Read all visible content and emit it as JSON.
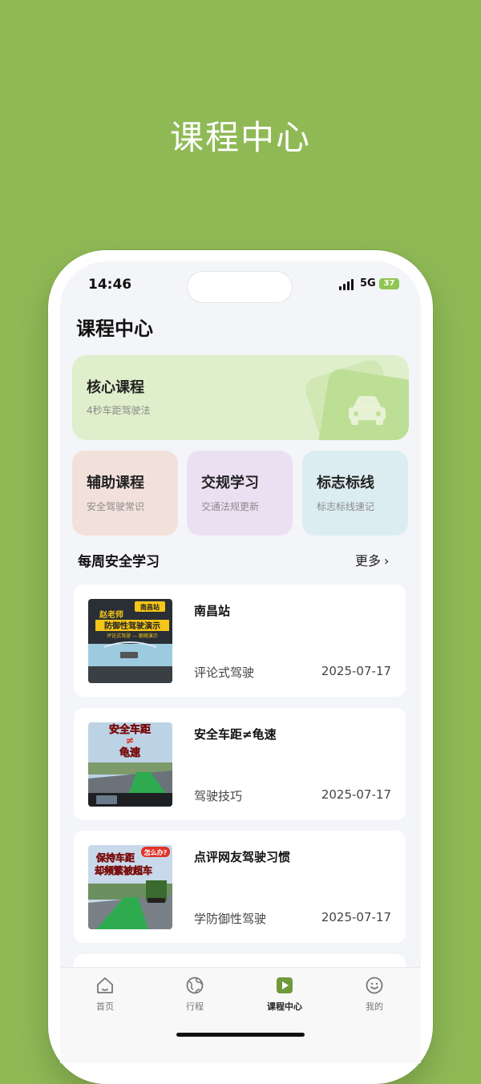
{
  "hero_title": "课程中心",
  "status_bar": {
    "time": "14:46",
    "network": "5G",
    "battery": "37"
  },
  "page_title": "课程中心",
  "core_card": {
    "title": "核心课程",
    "subtitle": "4秒车距驾驶法",
    "icon": "car-icon"
  },
  "sub_cards": [
    {
      "title": "辅助课程",
      "subtitle": "安全驾驶常识",
      "color": "#f2e1db"
    },
    {
      "title": "交规学习",
      "subtitle": "交通法规更新",
      "color": "#ebe0f2"
    },
    {
      "title": "标志标线",
      "subtitle": "标志标线速记",
      "color": "#dcedf2"
    }
  ],
  "section": {
    "title": "每周安全学习",
    "more": "更多"
  },
  "thumbnails": {
    "t1": {
      "location": "南昌站",
      "line1": "赵老师",
      "line2": "防御性驾驶演示",
      "line3": "评论式驾驶 — 跟随演示"
    },
    "t2": {
      "line1": "安全车距",
      "line2": "≠",
      "line3": "龟速"
    },
    "t3": {
      "badge": "怎么办?",
      "line1": "保持车距",
      "line2": "却频繁被超车"
    }
  },
  "videos": [
    {
      "title": "南昌站",
      "tag": "评论式驾驶",
      "date": "2025-07-17"
    },
    {
      "title": "安全车距≠龟速",
      "tag": "驾驶技巧",
      "date": "2025-07-17"
    },
    {
      "title": "点评网友驾驶习惯",
      "tag": "学防御性驾驶",
      "date": "2025-07-17"
    }
  ],
  "tabs": [
    {
      "label": "首页",
      "icon": "home-icon"
    },
    {
      "label": "行程",
      "icon": "globe-icon"
    },
    {
      "label": "课程中心",
      "icon": "play-icon",
      "active": true
    },
    {
      "label": "我的",
      "icon": "smile-icon"
    }
  ],
  "colors": {
    "brand": "#8fb955",
    "active_tab": "#6f9a3b",
    "core_card": "#dfeecb"
  }
}
